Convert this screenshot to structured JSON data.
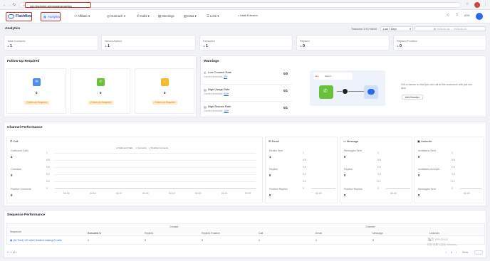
{
  "browser": {
    "url": "info.flashintel.ai/engage/analytics"
  },
  "nav": {
    "brand": "Flashflow",
    "analytics": "Analytics",
    "items": [
      "Affiliate",
      "Outreach",
      "Calls",
      "Meetings",
      "Data",
      "Lists",
      "Install Extension"
    ],
    "avatar": "ATM"
  },
  "page": {
    "title": "Analytics",
    "timezone": "Timezone: UTC+08:00",
    "range": "Last 7 Days",
    "date_from": "2025-02-16",
    "date_to": "2025-02-22"
  },
  "stats": [
    {
      "label": "Total Contacts",
      "value": "1"
    },
    {
      "label": "Nexus Added",
      "value": "1"
    },
    {
      "label": "Executed",
      "value": "1"
    },
    {
      "label": "Replied",
      "value": "0"
    },
    {
      "label": "Replied Positive",
      "value": "0"
    }
  ],
  "followup": {
    "title": "Follow-Up Required",
    "cards": [
      {
        "value": "0",
        "btn": "Follow-Up Required"
      },
      {
        "value": "0",
        "btn": "Follow-Up Required"
      },
      {
        "value": "0",
        "btn": "Follow-Up Required"
      }
    ]
  },
  "warnings": {
    "title": "Warnings",
    "rows": [
      {
        "title": "Low Connect Rate",
        "sub": "Current threshold:",
        "pct": "5%",
        "value": "0/0"
      },
      {
        "title": "High Usage Rate",
        "sub": "Current threshold:",
        "pct": "50%",
        "value": "0/1"
      },
      {
        "title": "High Bounce Rate",
        "sub": "Current threshold:",
        "pct": "10%",
        "value": "0/1"
      }
    ],
    "promo_text": "Get a number so that you can call all the customers with just one click",
    "promo_btn": "Add Number",
    "flow_label": "https://..."
  },
  "channel": {
    "title": "Channel Performance",
    "call": {
      "title": "Call",
      "metrics": [
        {
          "l": "Outbound Calls",
          "v": "1"
        },
        {
          "l": "Connects",
          "v": "0"
        },
        {
          "l": "Positive Connects",
          "v": "0"
        }
      ],
      "legend": [
        "Outbound Calls",
        "Connects",
        "Positive Connects"
      ],
      "yticks": [
        "1",
        "0.8",
        "0.6",
        "0.4",
        "0.2",
        "0"
      ],
      "xticks": [
        "02-15",
        "02-16",
        "02-17",
        "02-18",
        "02-19",
        "02-20",
        "02-21",
        "02-22"
      ]
    },
    "email": {
      "title": "Email",
      "metrics": [
        {
          "l": "Emails Sent",
          "v": "1"
        },
        {
          "l": "Replies",
          "v": "0"
        },
        {
          "l": "Positive Replies",
          "v": "0"
        }
      ],
      "yticks": [
        "1",
        "0.8",
        "0.6",
        "0.4",
        "0.2",
        "0"
      ],
      "xtick": "02-15"
    },
    "message": {
      "title": "Message",
      "metrics": [
        {
          "l": "Messages Sent",
          "v": "0"
        },
        {
          "l": "Replies",
          "v": "0"
        },
        {
          "l": "Positive Replies",
          "v": "0"
        }
      ],
      "yticks": [
        "1",
        "0.8",
        "0.6",
        "0.4",
        "0.2",
        "0"
      ],
      "xtick": "02-15"
    },
    "linkedin": {
      "title": "LinkedIn",
      "metrics": [
        {
          "l": "Invitations Sent",
          "v": "0"
        },
        {
          "l": "Invitations Accepte...",
          "v": "0"
        },
        {
          "l": "Messages Sent",
          "v": "0"
        }
      ],
      "yticks": [
        "1",
        "0.8",
        "0.6",
        "0.4",
        "0.2",
        "0"
      ],
      "xtick": "02-15"
    }
  },
  "sequence": {
    "title": "Sequence Performance",
    "group_contact": "Contact",
    "group_channel": "Channel",
    "cols": [
      "Sequence",
      "Executed",
      "Replied",
      "Replied Positive",
      "Call",
      "Email",
      "Message",
      "LinkedIn"
    ],
    "row": {
      "name": "(AI-Tried) US sales leaders making AI calls",
      "vals": [
        "1",
        "0",
        "0",
        "1",
        "1",
        "0",
        "0"
      ]
    },
    "footer": "1 - 1 of 1",
    "goto": "Go to"
  },
  "watermark": {
    "line1": "激活 Windows",
    "line2": "转到\"设置\"以激活 Windows。"
  },
  "colors": {
    "accent": "#2a6af0",
    "email": "#4f8df0",
    "phone": "#67c23a",
    "bell": "#f5b82e",
    "legend_orange": "#f5a623",
    "legend_green": "#4caf50",
    "legend_blue": "#5b8ff9"
  }
}
